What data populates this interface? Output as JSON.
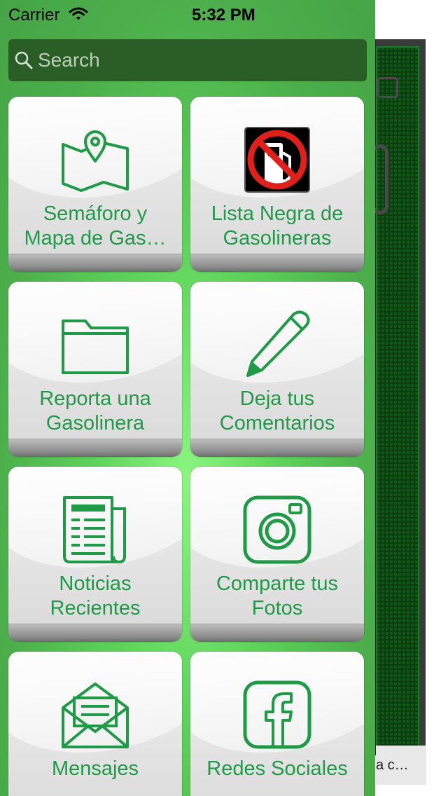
{
  "status_bar": {
    "carrier": "Carrier",
    "time": "5:32 PM"
  },
  "search": {
    "placeholder": "Search"
  },
  "menu_items": [
    {
      "line1": "Semáforo y",
      "line2": "Mapa de Gas…",
      "icon": "map-pin-icon"
    },
    {
      "line1": "Lista Negra de",
      "line2": "Gasolineras",
      "icon": "no-fuel-icon"
    },
    {
      "line1": "Reporta una",
      "line2": "Gasolinera",
      "icon": "folder-icon"
    },
    {
      "line1": "Deja tus",
      "line2": "Comentarios",
      "icon": "pencil-icon"
    },
    {
      "line1": "Noticias",
      "line2": "Recientes",
      "icon": "newspaper-icon"
    },
    {
      "line1": "Comparte tus",
      "line2": "Fotos",
      "icon": "camera-icon"
    },
    {
      "line1": "Mensajes",
      "line2": "",
      "icon": "envelope-icon"
    },
    {
      "line1": "Redes Sociales",
      "line2": "",
      "icon": "facebook-icon"
    }
  ],
  "background_app": {
    "caption": "a c…"
  },
  "colors": {
    "accent_green": "#1f9a46",
    "menu_green": "#4caf4b",
    "search_bg": "#2b5d27"
  }
}
